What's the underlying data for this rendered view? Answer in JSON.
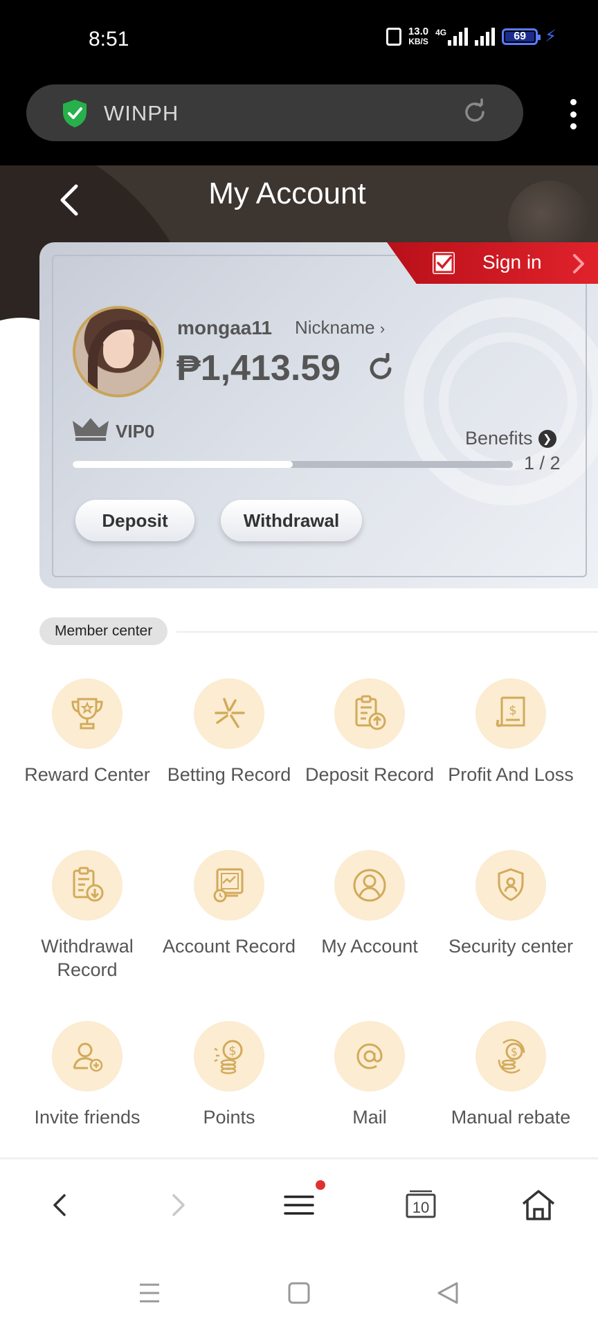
{
  "status_bar": {
    "time": "8:51",
    "net_speed_value": "13.0",
    "net_speed_unit": "KB/S",
    "network_type": "4G",
    "battery": "69"
  },
  "browser": {
    "url_text": "WINPH"
  },
  "header": {
    "title": "My Account"
  },
  "account_card": {
    "signin_label": "Sign in",
    "username": "mongaa11",
    "nickname_label": "Nickname",
    "currency_symbol": "₱",
    "balance": "1,413.59",
    "vip_label": "VIP0",
    "benefits_label": "Benefits",
    "progress_text": "1 / 2",
    "progress_fraction": 0.5,
    "deposit_label": "Deposit",
    "withdrawal_label": "Withdrawal"
  },
  "member_center": {
    "section_label": "Member center",
    "items": [
      {
        "label": "Reward Center",
        "icon": "trophy-icon"
      },
      {
        "label": "Betting Record",
        "icon": "betting-record-icon"
      },
      {
        "label": "Deposit Record",
        "icon": "deposit-record-icon"
      },
      {
        "label": "Profit And Loss",
        "icon": "profit-loss-icon"
      },
      {
        "label": "Withdrawal Record",
        "icon": "withdrawal-record-icon"
      },
      {
        "label": "Account Record",
        "icon": "account-record-icon"
      },
      {
        "label": "My Account",
        "icon": "user-icon"
      },
      {
        "label": "Security center",
        "icon": "security-shield-icon"
      },
      {
        "label": "Invite friends",
        "icon": "invite-friends-icon"
      },
      {
        "label": "Points",
        "icon": "coins-icon"
      },
      {
        "label": "Mail",
        "icon": "at-sign-icon"
      },
      {
        "label": "Manual rebate",
        "icon": "rebate-coins-icon"
      }
    ]
  },
  "bottom_nav": {
    "tabs_count": "10"
  },
  "colors": {
    "accent_gold": "#d2aa5a",
    "icon_bg": "#fbecd2",
    "signin_red": "#d61c25",
    "header_dark": "#3c3530"
  }
}
